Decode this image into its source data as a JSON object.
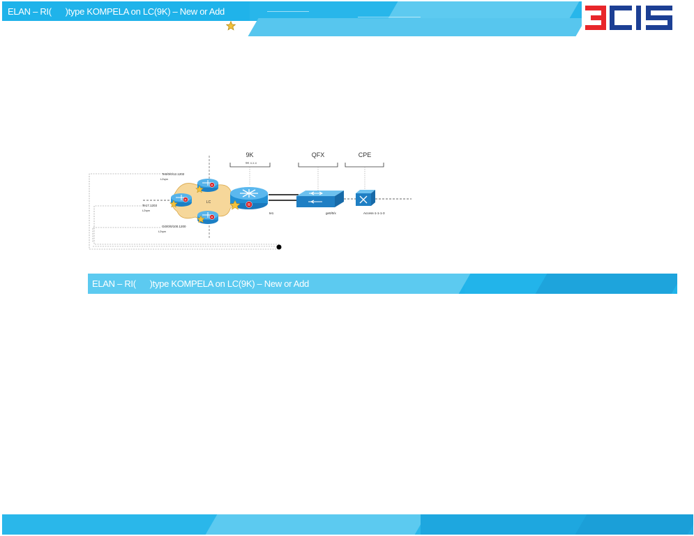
{
  "header": {
    "title": "ELAN – RI(      )type KOMPELA on LC(9K) – New or Add",
    "logo_text": "3CIS"
  },
  "section": {
    "title": "ELAN – RI(      )type KOMPELA on LC(9K) – New or Add"
  },
  "diagram": {
    "groups": [
      {
        "label": "9K",
        "sublabel": "9K x.x.x"
      },
      {
        "label": "QFX",
        "sublabel": ""
      },
      {
        "label": "CPE",
        "sublabel": ""
      }
    ],
    "cloud_label": "LC",
    "router_badges": [
      "R",
      "R",
      "R",
      "R"
    ],
    "core_badge": "R",
    "interfaces": [
      {
        "name": "Te0/0/0/12.1202",
        "encap": "L2vpn"
      },
      {
        "name": "Te17.1203",
        "encap": "L2vpn"
      },
      {
        "name": "Gi0/0/0/100.1200",
        "encap": "L2vpn"
      }
    ],
    "link_labels": {
      "core_port": "te1",
      "qfx_port": "ge0/0/x",
      "cpe_port": "Access-1-1-1-3"
    }
  },
  "colors": {
    "band_primary": "#1fb3ea",
    "band_light": "#5ccaf0",
    "logo_red": "#e8262a",
    "logo_blue": "#1c3f94",
    "device_blue": "#1a8fd6",
    "star": "#f3c13a"
  }
}
